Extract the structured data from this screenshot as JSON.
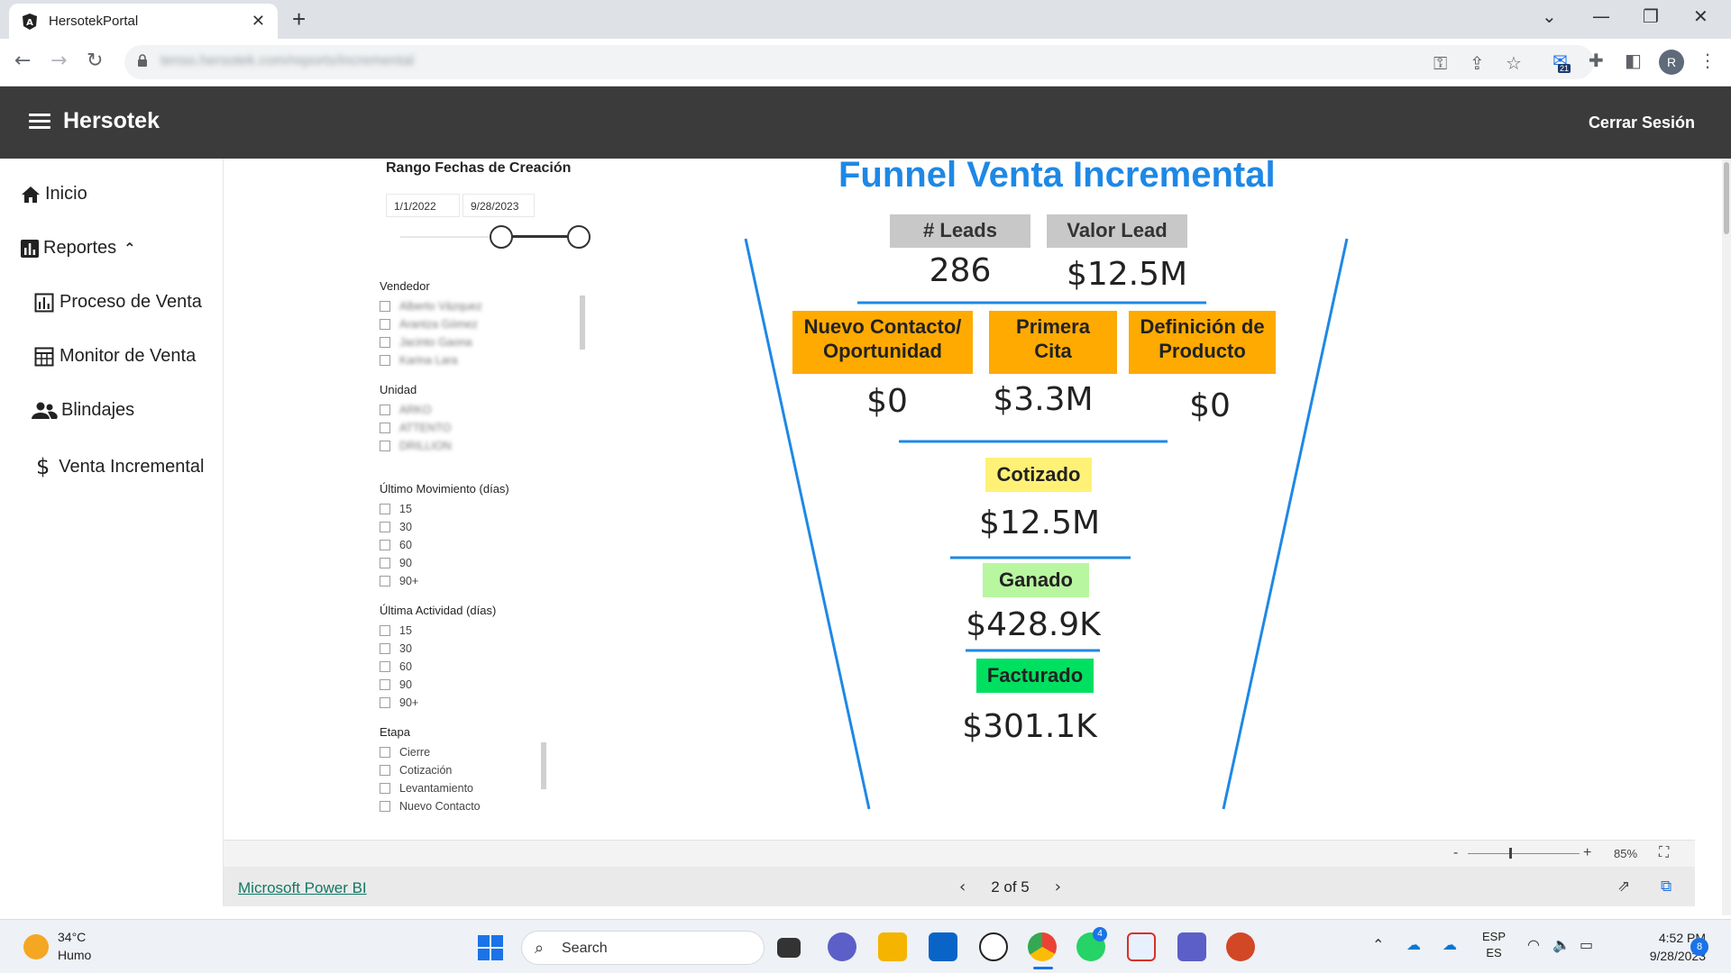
{
  "browser": {
    "tab_title": "HersotekPortal",
    "url": "tenso.hersotek.com/reports/incremental",
    "extension_badge": "21",
    "profile_initial": "R"
  },
  "header": {
    "brand": "Hersotek",
    "logout": "Cerrar Sesión"
  },
  "sidebar": {
    "items": [
      {
        "label": "Inicio",
        "icon": "home-icon"
      },
      {
        "label": "Reportes",
        "icon": "report-icon"
      },
      {
        "label": "Proceso de Venta",
        "icon": "chart-icon"
      },
      {
        "label": "Monitor de Venta",
        "icon": "calculator-icon"
      },
      {
        "label": "Blindajes",
        "icon": "people-icon"
      },
      {
        "label": "Venta Incremental",
        "icon": "dollar-icon"
      }
    ]
  },
  "filters": {
    "date_range_title": "Rango Fechas de Creación",
    "date_start": "1/1/2022",
    "date_end": "9/28/2023",
    "vendedor": {
      "title": "Vendedor",
      "options": [
        "Alberto Vázquez",
        "Arantza Gómez",
        "Jacinto Gaona",
        "Karina Lara"
      ]
    },
    "unidad": {
      "title": "Unidad",
      "options": [
        "ARKO",
        "ATTENTO",
        "DRILLION"
      ]
    },
    "ultimo_movimiento": {
      "title": "Último Movimiento (días)",
      "options": [
        "15",
        "30",
        "60",
        "90",
        "90+"
      ]
    },
    "ultima_actividad": {
      "title": "Última Actividad (días)",
      "options": [
        "15",
        "30",
        "60",
        "90",
        "90+"
      ]
    },
    "etapa": {
      "title": "Etapa",
      "options": [
        "Cierre",
        "Cotización",
        "Levantamiento",
        "Nuevo Contacto"
      ]
    }
  },
  "funnel": {
    "title": "Funnel Venta Incremental",
    "leads_label": "# Leads",
    "leads_value": "286",
    "valor_lead_label": "Valor Lead",
    "valor_lead_value": "$12.5M",
    "stage1": {
      "label_l1": "Nuevo Contacto/",
      "label_l2": "Oportunidad",
      "value": "$0"
    },
    "stage2": {
      "label_l1": "Primera",
      "label_l2": "Cita",
      "value": "$3.3M"
    },
    "stage3": {
      "label_l1": "Definición de",
      "label_l2": "Producto",
      "value": "$0"
    },
    "cotizado": {
      "label": "Cotizado",
      "value": "$12.5M",
      "color": "#fff176"
    },
    "ganado": {
      "label": "Ganado",
      "value": "$428.9K",
      "color": "#b9f6a0"
    },
    "facturado": {
      "label": "Facturado",
      "value": "$301.1K",
      "color": "#00e060"
    },
    "accent": "#1e88e5",
    "stage_color": "#ffaa00"
  },
  "powerbi": {
    "zoom_minus": "-",
    "zoom_plus": "+",
    "zoom_level": "85%",
    "link": "Microsoft Power BI",
    "page_indicator": "2 of 5"
  },
  "taskbar": {
    "temperature": "34°C",
    "weather": "Humo",
    "search_placeholder": "Search",
    "outlook_badge": "",
    "whatsapp_badge": "4",
    "lang_l1": "ESP",
    "lang_l2": "ES",
    "time": "4:52 PM",
    "date": "9/28/2023",
    "notifications": "8"
  }
}
